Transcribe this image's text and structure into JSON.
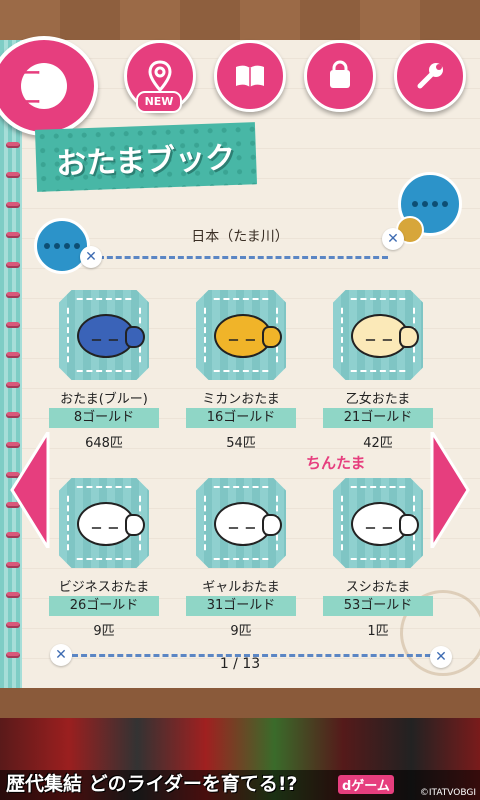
{
  "nav": {
    "logo_face": "ー ー",
    "items": [
      {
        "name": "map",
        "icon": "map-pin-icon",
        "badge": "NEW"
      },
      {
        "name": "book",
        "icon": "book-icon"
      },
      {
        "name": "shop",
        "icon": "bag-icon"
      },
      {
        "name": "settings",
        "icon": "wrench-icon"
      }
    ]
  },
  "title": "おたまブック",
  "region": "日本（たま川）",
  "cards": [
    {
      "name": "おたま(ブルー)",
      "price": "8ゴールド",
      "count": "648匹",
      "color": "#3a63b8"
    },
    {
      "name": "ミカンおたま",
      "price": "16ゴールド",
      "count": "54匹",
      "color": "#f0b429"
    },
    {
      "name": "乙女おたま",
      "price": "21ゴールド",
      "count": "42匹",
      "color": "#fbe9b8"
    },
    {
      "name": "ビジネスおたま",
      "price": "26ゴールド",
      "count": "9匹",
      "color": "#ffffff"
    },
    {
      "name": "ギャルおたま",
      "price": "31ゴールド",
      "count": "9匹",
      "color": "#ffffff"
    },
    {
      "name": "スシおたま",
      "price": "53ゴールド",
      "count": "1匹",
      "color": "#ffffff"
    }
  ],
  "annotation": "ちんたま",
  "pager": "1 / 13",
  "banner": {
    "text": "歴代集結 どのライダーを育てる!?",
    "logo": "dゲーム",
    "copyright": "©ITATVOBGI"
  },
  "colors": {
    "accent": "#e63e7e",
    "teal": "#8fd0cf"
  }
}
